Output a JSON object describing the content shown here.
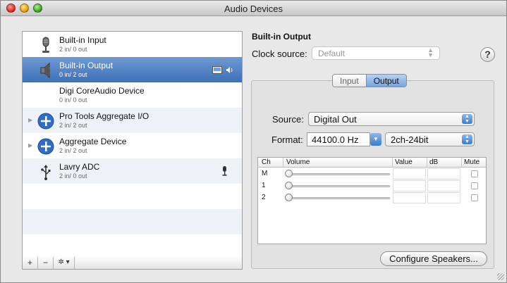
{
  "window": {
    "title": "Audio Devices"
  },
  "devices": [
    {
      "name": "Built-in Input",
      "io": "2 in/ 0 out",
      "icon": "microphone-icon",
      "selected": false
    },
    {
      "name": "Built-in Output",
      "io": "0 in/ 2 out",
      "icon": "speaker-icon",
      "selected": true
    },
    {
      "name": "Digi CoreAudio Device",
      "io": "0 in/ 0 out",
      "icon": "",
      "selected": false
    },
    {
      "name": "Pro Tools Aggregate I/O",
      "io": "2 in/ 2 out",
      "icon": "aggregate-plus-icon",
      "selected": false
    },
    {
      "name": "Aggregate Device",
      "io": "2 in/ 2 out",
      "icon": "aggregate-plus-icon",
      "selected": false
    },
    {
      "name": "Lavry  ADC",
      "io": "2 in/ 0 out",
      "icon": "usb-icon",
      "selected": false
    }
  ],
  "list_toolbar": {
    "add": "+",
    "remove": "−",
    "action": "✲ ▾"
  },
  "detail": {
    "heading": "Built-in Output",
    "clock_label": "Clock source:",
    "clock_value": "Default",
    "help": "?",
    "tabs": {
      "input": "Input",
      "output": "Output",
      "active": "Output"
    },
    "source_label": "Source:",
    "source_value": "Digital Out",
    "format_label": "Format:",
    "format_rate": "44100.0 Hz",
    "format_bits": "2ch-24bit",
    "table": {
      "headers": {
        "ch": "Ch",
        "volume": "Volume",
        "value": "Value",
        "db": "dB",
        "mute": "Mute"
      },
      "rows": [
        {
          "ch": "M"
        },
        {
          "ch": "1"
        },
        {
          "ch": "2"
        }
      ]
    },
    "configure_label": "Configure Speakers..."
  },
  "colors": {
    "selection": "#3e6fb6",
    "accent_blue": "#3b7bd0"
  }
}
